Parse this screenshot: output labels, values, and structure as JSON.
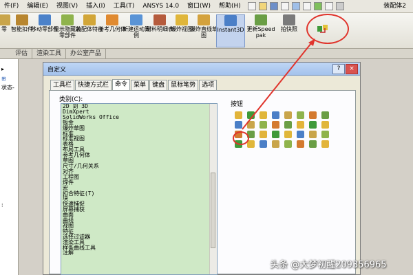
{
  "menubar": {
    "items": [
      "件(F)",
      "编辑(E)",
      "视图(V)",
      "插入(I)",
      "工具(T)",
      "ANSYS 14.0",
      "窗口(W)",
      "帮助(H)"
    ],
    "doc_title": "装配体2"
  },
  "ribbon": {
    "buttons": [
      {
        "label": "零",
        "icon": "part-icon",
        "color": "#c9a54a"
      },
      {
        "label": "智能扣件",
        "icon": "fastener-icon",
        "color": "#b8862f"
      },
      {
        "label": "移动零部件",
        "icon": "move-component-icon",
        "color": "#4c82c9"
      },
      {
        "label": "显示隐藏的零部件",
        "icon": "show-hidden-icon",
        "color": "#8fb34c"
      },
      {
        "label": "装配体特征",
        "icon": "assembly-feature-icon",
        "color": "#d2a638"
      },
      {
        "label": "参考几何体",
        "icon": "reference-geometry-icon",
        "color": "#e08a30"
      },
      {
        "label": "新建运动算例",
        "icon": "motion-study-icon",
        "color": "#5a94d6"
      },
      {
        "label": "材料明细表",
        "icon": "bom-icon",
        "color": "#b55b3c"
      },
      {
        "label": "爆炸视图",
        "icon": "explode-view-icon",
        "color": "#e0b63a"
      },
      {
        "label": "爆炸直线草图",
        "icon": "explode-line-sketch-icon",
        "color": "#d4a23d"
      },
      {
        "label": "Instant3D",
        "icon": "instant3d-icon",
        "color": "#4b7fc7"
      },
      {
        "label": "更新Speedpak",
        "icon": "speedpak-icon",
        "color": "#6a9e45"
      },
      {
        "label": "拍快照",
        "icon": "snapshot-icon",
        "color": "#7a7a7a"
      }
    ]
  },
  "tabstrip": {
    "tabs": [
      "评估",
      "渲染工具",
      "办公室产品"
    ]
  },
  "leftpanel": {
    "status_text": "状态-"
  },
  "dialog": {
    "title": "自定义",
    "help": "?",
    "close": "×",
    "tabs": [
      "工具栏",
      "快捷方式栏",
      "命令",
      "菜单",
      "键盘",
      "鼠标笔势",
      "选项"
    ],
    "active_tab": 2,
    "category_label": "类别(C):",
    "categories": [
      "2D 到 3D",
      "DimXpert",
      "SolidWorks Office",
      "钣金",
      "爆炸草图",
      "标准",
      "标准视图",
      "表格",
      "布局工具",
      "参考几何体",
      "草图",
      "尺寸/几何关系",
      "对齐",
      "工程图",
      "焊件",
      "宏",
      "扣合特征(T)",
      "块",
      "快速捕捉",
      "屏幕捕获",
      "曲面",
      "曲线",
      "视图",
      "特征",
      "选择过滤器",
      "渲染工具",
      "样条曲线工具",
      "注解"
    ],
    "button_label": "按钮"
  },
  "watermark": "头条 @大梦初醒209356965"
}
